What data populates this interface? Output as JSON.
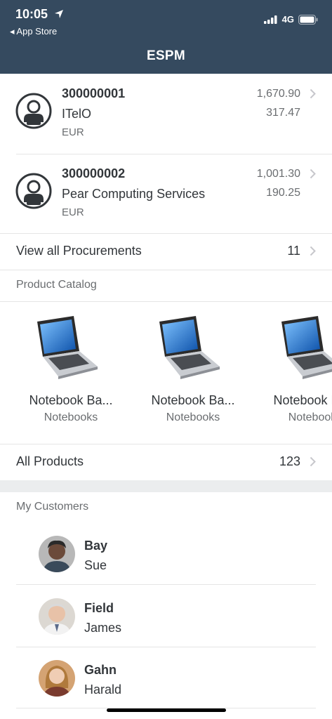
{
  "status_bar": {
    "time": "10:05",
    "back_app": "◂ App Store",
    "network": "4G"
  },
  "header": {
    "title": "ESPM"
  },
  "procurements": [
    {
      "id": "300000001",
      "name": "ITelO",
      "currency": "EUR",
      "amount_primary": "1,670.90",
      "amount_secondary": "317.47"
    },
    {
      "id": "300000002",
      "name": "Pear Computing Services",
      "currency": "EUR",
      "amount_primary": "1,001.30",
      "amount_secondary": "190.25"
    }
  ],
  "view_all_procurements": {
    "label": "View all Procurements",
    "count": "11"
  },
  "product_catalog": {
    "header": "Product Catalog",
    "products": [
      {
        "name": "Notebook Ba...",
        "category": "Notebooks"
      },
      {
        "name": "Notebook Ba...",
        "category": "Notebooks"
      },
      {
        "name": "Notebook Ba...",
        "category": "Notebooks"
      }
    ]
  },
  "all_products": {
    "label": "All Products",
    "count": "123"
  },
  "customers": {
    "header": "My Customers",
    "items": [
      {
        "last_name": "Bay",
        "first_name": "Sue"
      },
      {
        "last_name": "Field",
        "first_name": "James"
      },
      {
        "last_name": "Gahn",
        "first_name": "Harald"
      }
    ]
  },
  "colors": {
    "header_bg": "#354a5f",
    "text": "#32363a",
    "secondary_text": "#6a6d70",
    "band": "#ebedee"
  }
}
